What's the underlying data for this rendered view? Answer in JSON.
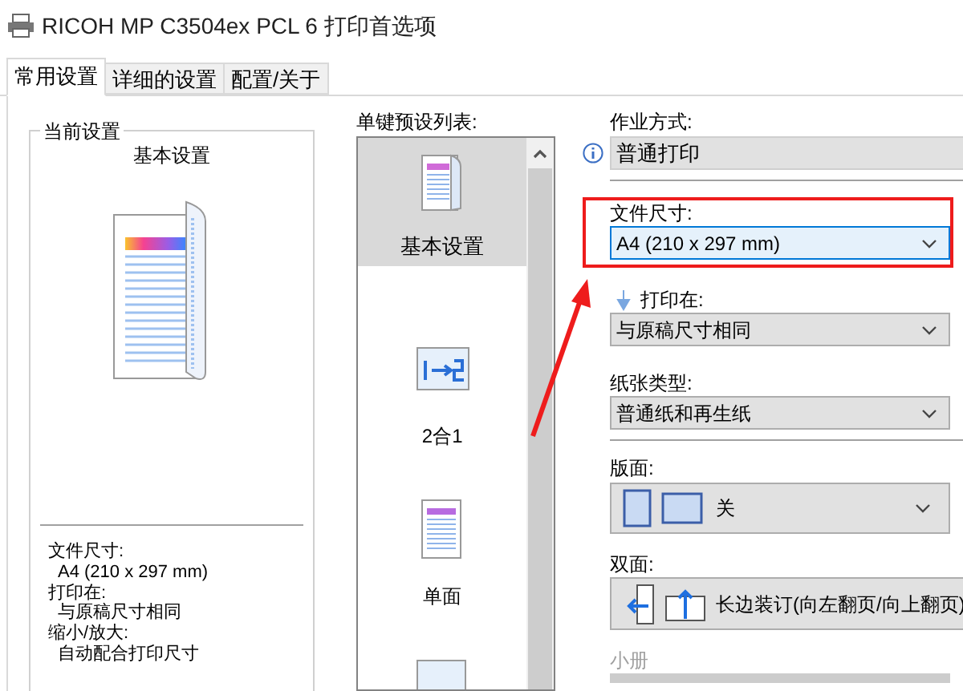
{
  "window": {
    "title": "RICOH MP C3504ex PCL 6 打印首选项"
  },
  "tabs": [
    {
      "label": "常用设置",
      "selected": true
    },
    {
      "label": "详细的设置",
      "selected": false
    },
    {
      "label": "配置/关于",
      "selected": false
    }
  ],
  "current_settings": {
    "title": "当前设置",
    "preset_name": "基本设置",
    "summary": [
      {
        "label": "文件尺寸:",
        "value": "A4 (210 x 297 mm)"
      },
      {
        "label": "打印在:",
        "value": "与原稿尺寸相同"
      },
      {
        "label": "缩小/放大:",
        "value": "自动配合打印尺寸"
      }
    ]
  },
  "preset_list": {
    "label": "单键预设列表:",
    "items": [
      {
        "kind": "basic",
        "label": "基本设置",
        "selected": true
      },
      {
        "kind": "two_in_one",
        "label": "2合1",
        "selected": false
      },
      {
        "kind": "single_sided",
        "label": "单面",
        "selected": false
      },
      {
        "kind": "booklet",
        "selected": false
      }
    ]
  },
  "settings": [
    {
      "kind": "static",
      "label": "作业方式:",
      "value": "普通打印",
      "highlighted": false,
      "divider_after": true
    },
    {
      "kind": "select",
      "label": "文件尺寸:",
      "value": "A4 (210 x 297 mm)",
      "focused": true,
      "highlighted": true,
      "divider_after": false
    },
    {
      "kind": "select",
      "label": "打印在:",
      "value": "与原稿尺寸相同",
      "focused": false,
      "highlighted": false,
      "divider_after": false
    },
    {
      "kind": "select",
      "label": "纸张类型:",
      "value": "普通纸和再生纸",
      "focused": false,
      "highlighted": false,
      "divider_after": true
    },
    {
      "kind": "layout",
      "label": "版面:",
      "value": "关",
      "highlighted": false,
      "divider_after": false
    },
    {
      "kind": "duplex",
      "label": "双面:",
      "value": "长边装订(向左翻页/向上翻页)",
      "highlighted": false,
      "divider_after": false
    },
    {
      "kind": "disabled_label",
      "label": "小册",
      "highlighted": false,
      "divider_after": false
    }
  ]
}
